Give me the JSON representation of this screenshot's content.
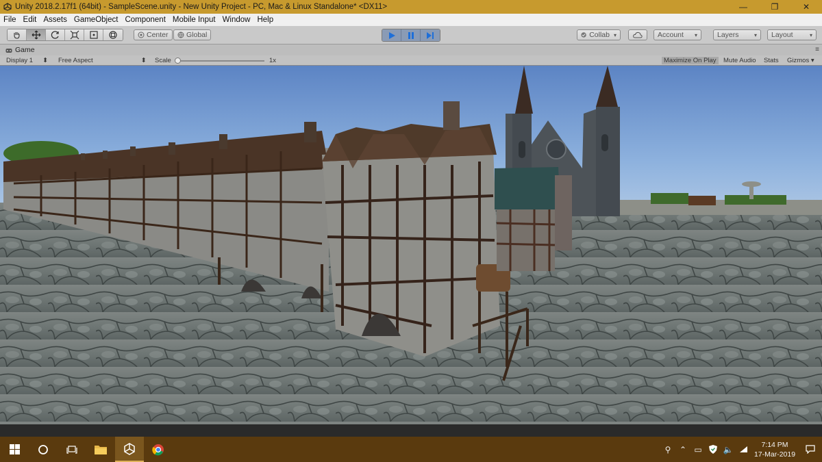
{
  "window": {
    "title": "Unity 2018.2.17f1 (64bit) - SampleScene.unity - New Unity Project - PC, Mac & Linux Standalone* <DX11>",
    "minimize": "—",
    "maximize": "❐",
    "close": "✕"
  },
  "menu": [
    "File",
    "Edit",
    "Assets",
    "GameObject",
    "Component",
    "Mobile Input",
    "Window",
    "Help"
  ],
  "toolbar": {
    "tools": [
      "hand-tool",
      "move-tool",
      "rotate-tool",
      "scale-tool",
      "rect-tool",
      "transform-tool"
    ],
    "active_tool": "move-tool",
    "pivot_label": "Center",
    "space_label": "Global",
    "collab_label": "Collab",
    "account_label": "Account",
    "layers_label": "Layers",
    "layout_label": "Layout"
  },
  "game_view": {
    "tab_label": "Game",
    "display_label": "Display 1",
    "aspect_label": "Free Aspect",
    "scale_label": "Scale",
    "scale_value": "1x",
    "maximize_on_play": "Maximize On Play",
    "mute_audio": "Mute Audio",
    "stats": "Stats",
    "gizmos": "Gizmos"
  },
  "taskbar": {
    "apps": [
      "windows-start",
      "cortana-search",
      "task-view",
      "file-explorer",
      "unity",
      "chrome"
    ],
    "active_app": "unity",
    "time": "7:14 PM",
    "date": "17-Mar-2019"
  },
  "colors": {
    "title_bar": "#c79a2e",
    "taskbar": "#5a3a0e",
    "play_accent": "#1e6fd9"
  }
}
